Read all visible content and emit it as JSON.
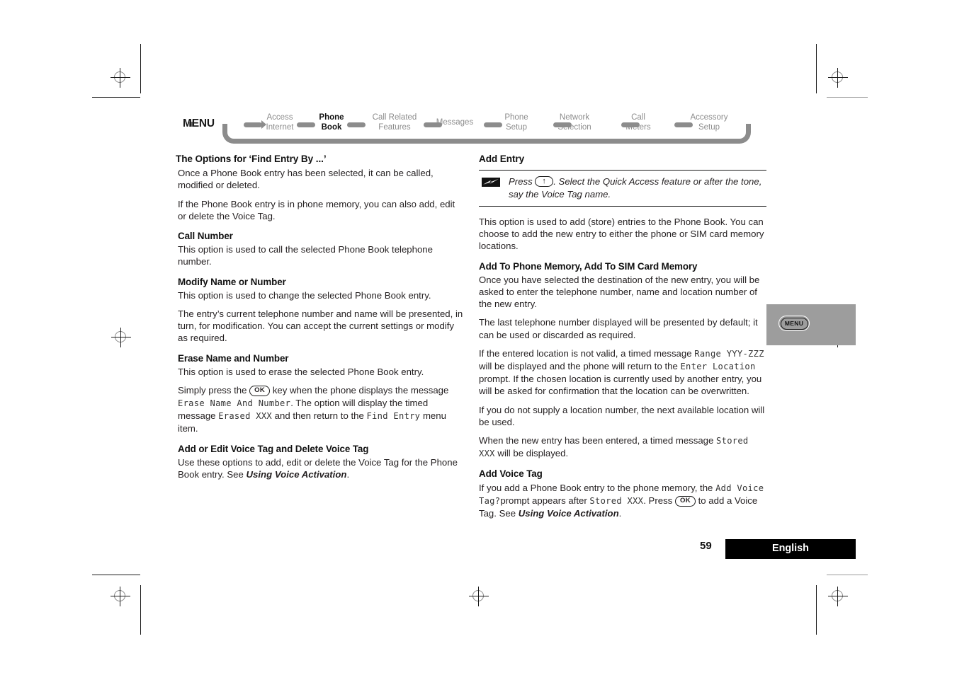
{
  "menu_map": {
    "root_label": "MENU",
    "items": [
      {
        "line1": "Access",
        "line2": "Internet",
        "current": false
      },
      {
        "line1": "Phone",
        "line2": "Book",
        "current": true
      },
      {
        "line1": "Call Related",
        "line2": "Features",
        "current": false
      },
      {
        "line1": "Messages",
        "line2": "",
        "current": false
      },
      {
        "line1": "Phone",
        "line2": "Setup",
        "current": false
      },
      {
        "line1": "Network",
        "line2": "Selection",
        "current": false
      },
      {
        "line1": "Call",
        "line2": "Meters",
        "current": false
      },
      {
        "line1": "Accessory",
        "line2": "Setup",
        "current": false
      }
    ]
  },
  "left_column": {
    "section_title": "The Options for ‘Find Entry By ...’",
    "intro_p1": "Once a Phone Book entry has been selected, it can be called, modified or deleted.",
    "intro_p2": "If the Phone Book entry is in phone memory, you can also add, edit or delete the Voice Tag.",
    "call_number": {
      "heading": "Call Number",
      "body": "This option is used to call the selected Phone Book telephone number."
    },
    "modify_name": {
      "heading": "Modify Name or Number",
      "body1": "This option is used to change the selected Phone Book entry.",
      "body2": "The entry’s current telephone number and name will be presented, in turn, for modification. You can accept the current settings or modify as required."
    },
    "erase_name": {
      "heading": "Erase Name and Number",
      "body1": "This option is used to erase the selected Phone Book entry.",
      "body2_a": "Simply press the",
      "body2_key": "OK",
      "body2_b": "key when the phone displays the message",
      "body2_lcd1": "Erase Name And Number",
      "body2_c": ". The option will display the timed message",
      "body2_lcd2": "Erased XXX",
      "body2_d": "and then return to the",
      "body2_lcd3": "Find Entry",
      "body2_e": "menu item."
    },
    "voice_tag": {
      "heading": "Add or Edit Voice Tag and Delete Voice Tag",
      "body_a": "Use these options to add, edit or delete the Voice Tag for the Phone Book entry. See",
      "body_ref": "Using Voice Activation",
      "body_b": "."
    }
  },
  "right_column": {
    "section_title": "Add Entry",
    "note": {
      "icon": "lightning-bolt-icon",
      "text_a": "Press",
      "key": "↑",
      "text_b": ". Select the Quick Access feature or after the tone, say the Voice Tag name."
    },
    "intro": "This option is used to add (store) entries to the Phone Book. You can choose to add the new entry to either the phone or SIM card memory locations.",
    "add_to_memory": {
      "heading": "Add To Phone Memory, Add To SIM Card Memory",
      "body1": "Once you have selected the destination of the new entry, you will be asked to enter the telephone number, name and location number of the new entry.",
      "body2": "The last telephone number displayed will be presented by default; it can be used or discarded as required.",
      "body3_a": "If the entered location is not valid, a timed message",
      "body3_lcd1": "Range YYY-ZZZ",
      "body3_b": "will be displayed and the phone will return to the",
      "body3_lcd2": "Enter Location",
      "body3_c": "prompt. If the chosen location is currently used by another entry, you will be asked for confirmation that the location can be overwritten.",
      "body4": "If you do not supply a location number, the next available location will be used.",
      "body5_a": "When the new entry has been entered, a timed message",
      "body5_lcd": "Stored XXX",
      "body5_b": "will be displayed."
    },
    "add_voice_tag": {
      "heading": "Add Voice Tag",
      "body_a": "If you add a Phone Book entry to the phone memory, the",
      "lcd1": "Add Voice Tag?",
      "body_b": "prompt appears after",
      "lcd2": "Stored XXX",
      "body_c": ". Press",
      "key": "OK",
      "body_d": "to add a Voice Tag. See",
      "ref": "Using Voice Activation",
      "body_e": "."
    }
  },
  "thumb_tab": {
    "button_label": "MENU"
  },
  "footer": {
    "page_number": "59",
    "language": "English"
  },
  "colors": {
    "menu_gray": "#8c8c8c",
    "tab_gray": "#9d9d9d",
    "footer_bar": "#000000",
    "text": "#231f20"
  }
}
